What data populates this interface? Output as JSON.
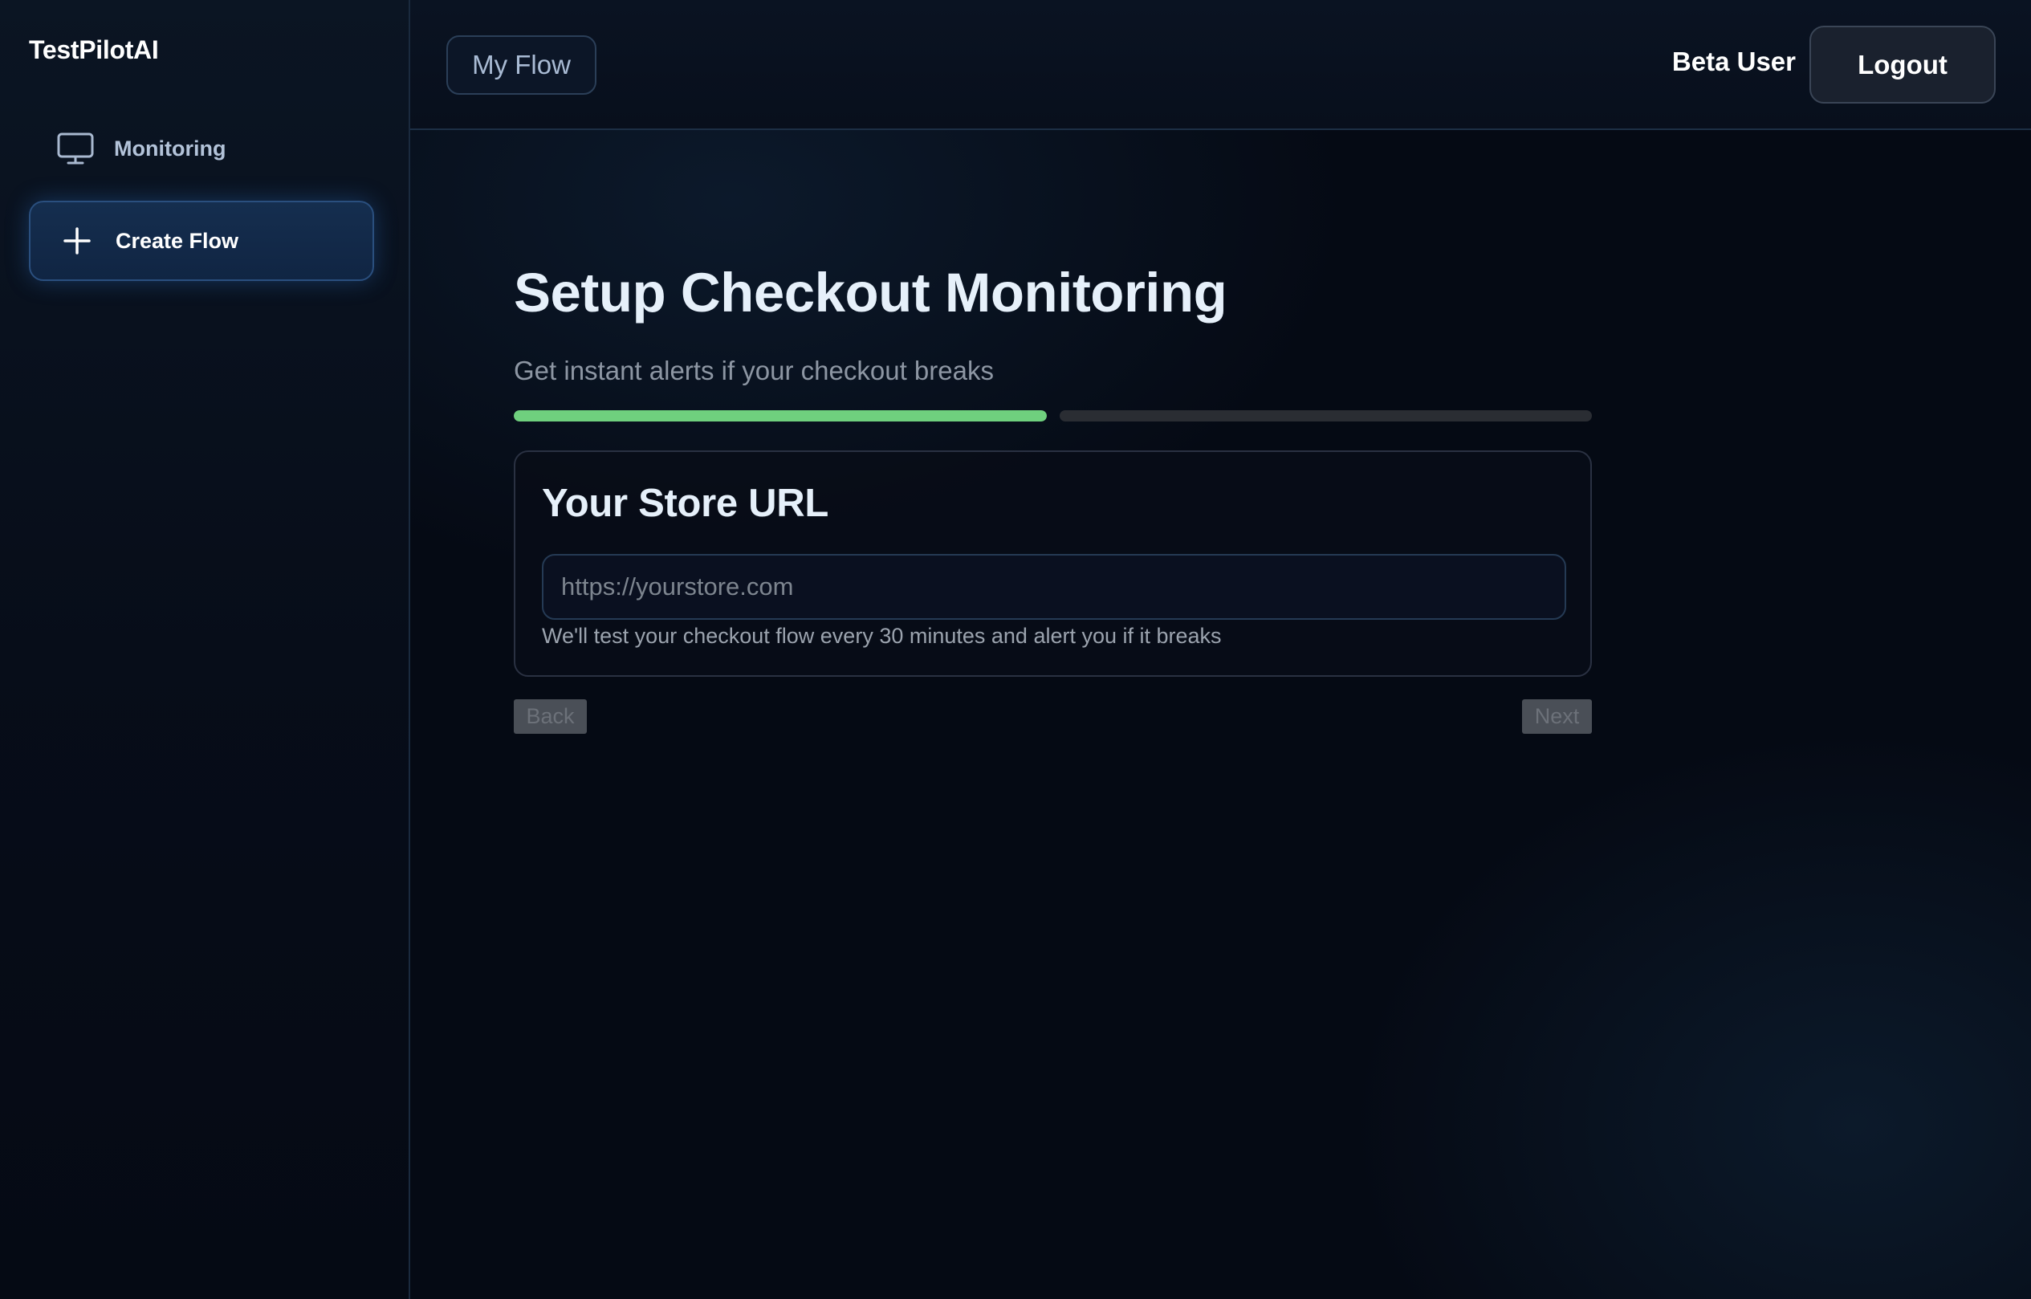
{
  "app": {
    "name": "TestPilotAI"
  },
  "sidebar": {
    "items": [
      {
        "label": "Monitoring",
        "icon": "monitor-icon",
        "active": false
      },
      {
        "label": "Create Flow",
        "icon": "plus-icon",
        "active": true
      }
    ]
  },
  "header": {
    "flow_chip": "My Flow",
    "user_name": "Beta User",
    "logout_label": "Logout"
  },
  "main": {
    "title": "Setup Checkout Monitoring",
    "subtitle": "Get instant alerts if your checkout breaks",
    "progress": {
      "current_step": 1,
      "total_steps": 2
    },
    "card": {
      "title": "Your Store URL",
      "input_value": "",
      "input_placeholder": "https://yourstore.com",
      "hint": "We'll test your checkout flow every 30 minutes and alert you if it breaks"
    },
    "actions": {
      "back_label": "Back",
      "next_label": "Next"
    }
  },
  "colors": {
    "background": "#050a14",
    "accent": "#2a4f7e",
    "progress_complete": "#6fd07e",
    "progress_pending": "#2a2d33"
  }
}
